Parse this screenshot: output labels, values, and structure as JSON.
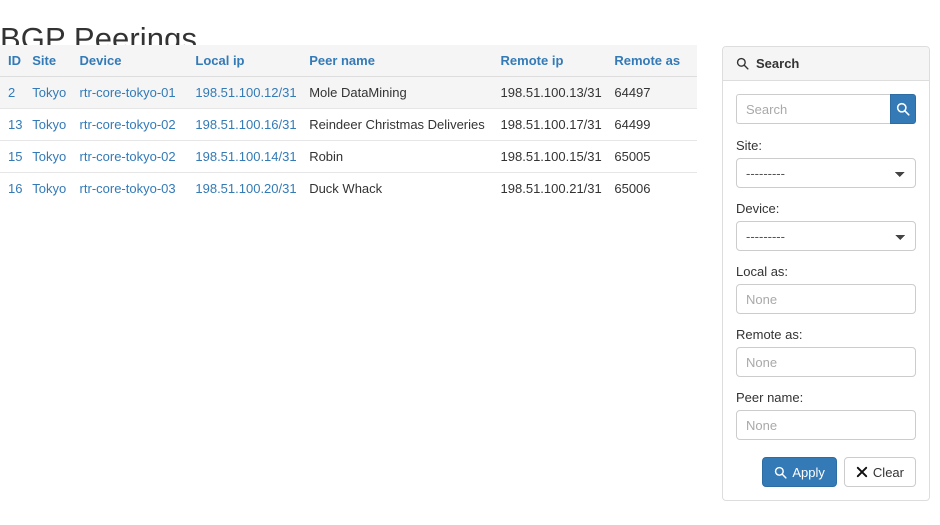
{
  "page": {
    "title": "BGP Peerings"
  },
  "table": {
    "columns": [
      {
        "key": "id",
        "label": "ID"
      },
      {
        "key": "site",
        "label": "Site"
      },
      {
        "key": "device",
        "label": "Device"
      },
      {
        "key": "local_ip",
        "label": "Local ip"
      },
      {
        "key": "peer_name",
        "label": "Peer name"
      },
      {
        "key": "remote_ip",
        "label": "Remote ip"
      },
      {
        "key": "remote_as",
        "label": "Remote as"
      }
    ],
    "rows": [
      {
        "id": "2",
        "site": "Tokyo",
        "device": "rtr-core-tokyo-01",
        "local_ip": "198.51.100.12/31",
        "peer_name": "Mole DataMining",
        "remote_ip": "198.51.100.13/31",
        "remote_as": "64497"
      },
      {
        "id": "13",
        "site": "Tokyo",
        "device": "rtr-core-tokyo-02",
        "local_ip": "198.51.100.16/31",
        "peer_name": "Reindeer Christmas Deliveries",
        "remote_ip": "198.51.100.17/31",
        "remote_as": "64499"
      },
      {
        "id": "15",
        "site": "Tokyo",
        "device": "rtr-core-tokyo-02",
        "local_ip": "198.51.100.14/31",
        "peer_name": "Robin",
        "remote_ip": "198.51.100.15/31",
        "remote_as": "65005"
      },
      {
        "id": "16",
        "site": "Tokyo",
        "device": "rtr-core-tokyo-03",
        "local_ip": "198.51.100.20/31",
        "peer_name": "Duck Whack",
        "remote_ip": "198.51.100.21/31",
        "remote_as": "65006"
      }
    ]
  },
  "search_panel": {
    "heading": "Search",
    "heading_icon": "search-icon",
    "quick_search": {
      "value": "",
      "placeholder": "Search",
      "button_icon": "search-icon"
    },
    "fields": [
      {
        "name": "site",
        "label": "Site:",
        "type": "select",
        "value": "---------"
      },
      {
        "name": "device",
        "label": "Device:",
        "type": "select",
        "value": "---------"
      },
      {
        "name": "local_as",
        "label": "Local as:",
        "type": "text",
        "value": "",
        "placeholder": "None"
      },
      {
        "name": "remote_as",
        "label": "Remote as:",
        "type": "text",
        "value": "",
        "placeholder": "None"
      },
      {
        "name": "peer_name",
        "label": "Peer name:",
        "type": "text",
        "value": "",
        "placeholder": "None"
      }
    ],
    "apply_label": "Apply",
    "apply_icon": "search-icon",
    "clear_label": "Clear",
    "clear_icon": "close-x-icon"
  },
  "colors": {
    "primary": "#337ab7",
    "link": "#337ab7",
    "text": "#333333",
    "panel_header_bg": "#f5f5f5",
    "border": "#dddddd",
    "stripe": "#f5f5f5",
    "placeholder": "#a9a9a9"
  }
}
